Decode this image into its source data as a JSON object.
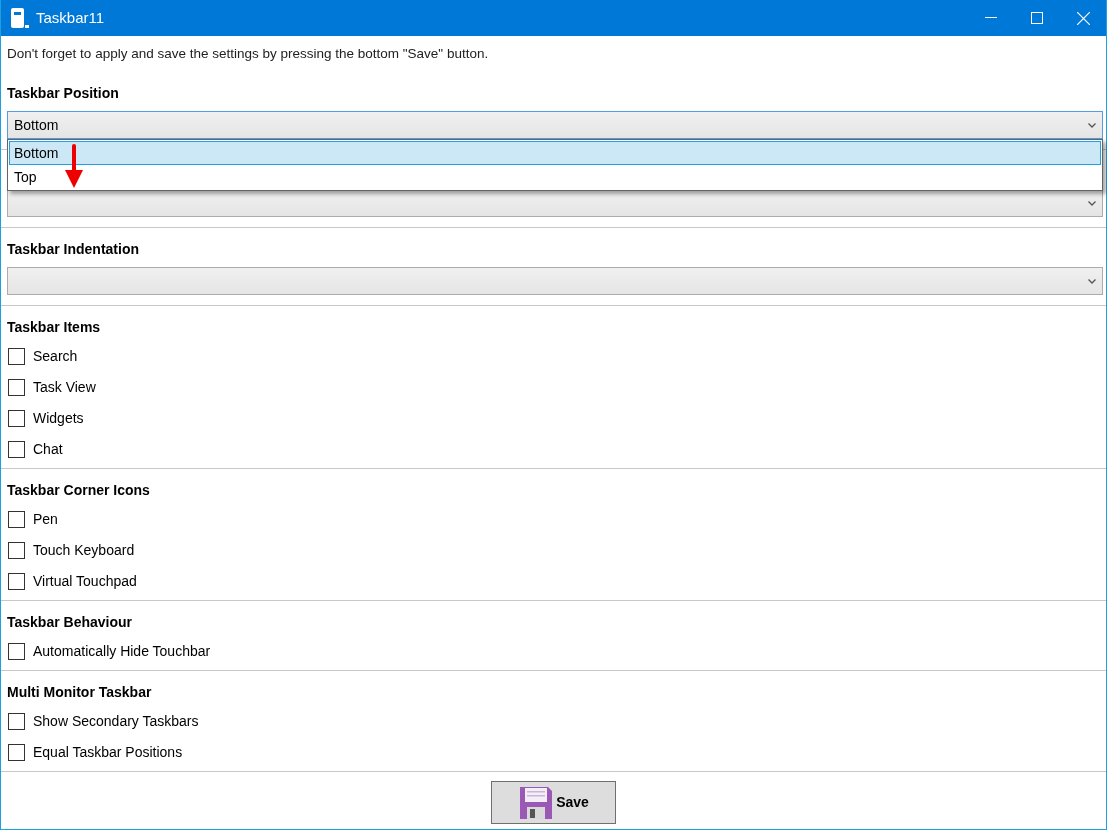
{
  "window": {
    "title": "Taskbar11"
  },
  "notice": "Don't forget to apply and save the settings by pressing the bottom \"Save\" button.",
  "sections": [
    {
      "kind": "dropdown",
      "title": "Taskbar Position",
      "value": "Bottom",
      "expanded": true,
      "options": [
        {
          "label": "Bottom",
          "selected": true
        },
        {
          "label": "Top",
          "selected": false
        }
      ]
    },
    {
      "kind": "dropdown",
      "expanded": false
    },
    {
      "kind": "dropdown",
      "title": "Taskbar Indentation",
      "expanded": false
    },
    {
      "kind": "checkboxes",
      "title": "Taskbar Items",
      "items": [
        {
          "label": "Search",
          "checked": false
        },
        {
          "label": "Task View",
          "checked": false
        },
        {
          "label": "Widgets",
          "checked": false
        },
        {
          "label": "Chat",
          "checked": false
        }
      ]
    },
    {
      "kind": "checkboxes",
      "title": "Taskbar Corner Icons",
      "items": [
        {
          "label": "Pen",
          "checked": false
        },
        {
          "label": "Touch Keyboard",
          "checked": false
        },
        {
          "label": "Virtual Touchpad",
          "checked": false
        }
      ]
    },
    {
      "kind": "checkboxes",
      "title": "Taskbar Behaviour",
      "items": [
        {
          "label": "Automatically Hide Touchbar",
          "checked": false
        }
      ]
    },
    {
      "kind": "checkboxes",
      "title": "Multi Monitor Taskbar",
      "items": [
        {
          "label": "Show Secondary Taskbars",
          "checked": false
        },
        {
          "label": "Equal Taskbar Positions",
          "checked": false
        }
      ]
    }
  ],
  "save_button": {
    "label": "Save"
  }
}
